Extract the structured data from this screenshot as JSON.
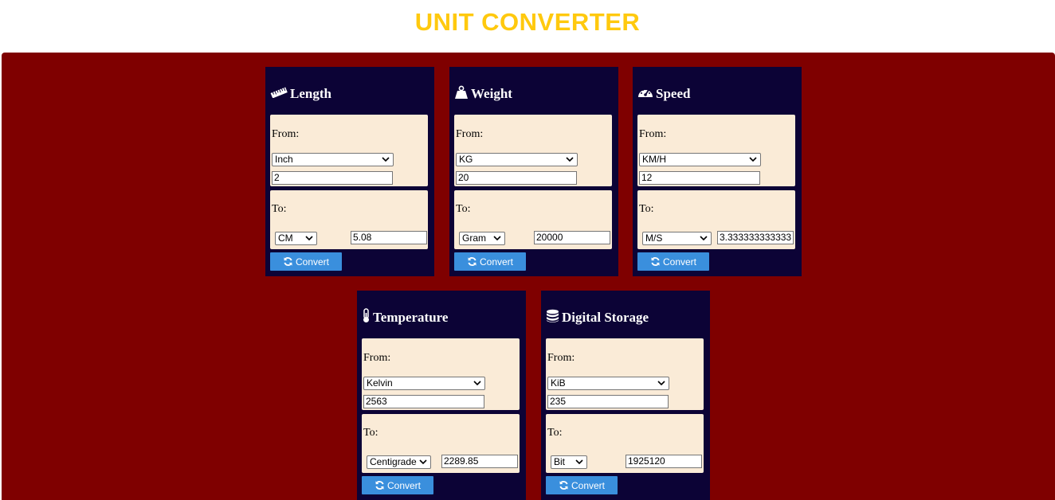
{
  "page": {
    "title": "UNIT CONVERTER"
  },
  "common": {
    "from_label": "From:",
    "to_label": "To:",
    "button_label": "Convert"
  },
  "converters": {
    "length": {
      "title": "Length",
      "icon": "ruler-icon",
      "from_unit": "Inch",
      "from_value": "2",
      "to_unit": "CM",
      "to_value": "5.08"
    },
    "weight": {
      "title": "Weight",
      "icon": "weight-icon",
      "from_unit": "KG",
      "from_value": "20",
      "to_unit": "Gram",
      "to_value": "20000"
    },
    "speed": {
      "title": "Speed",
      "icon": "speedometer-icon",
      "from_unit": "KM/H",
      "from_value": "12",
      "to_unit": "M/S",
      "to_value": "3.333333333333"
    },
    "temperature": {
      "title": "Temperature",
      "icon": "thermometer-icon",
      "from_unit": "Kelvin",
      "from_value": "2563",
      "to_unit": "Centigrade",
      "to_value": "2289.85"
    },
    "storage": {
      "title": "Digital Storage",
      "icon": "database-icon",
      "from_unit": "KiB",
      "from_value": "235",
      "to_unit": "Bit",
      "to_value": "1925120"
    }
  },
  "colors": {
    "title": "#ffc90e",
    "background": "#7f0000",
    "card": "#0c0336",
    "panel": "#faebd7",
    "button": "#3a8fdd"
  }
}
